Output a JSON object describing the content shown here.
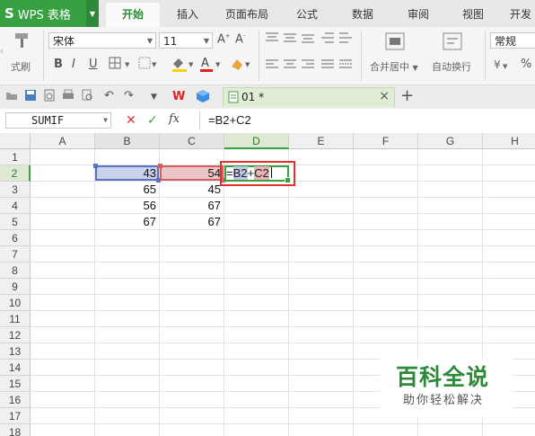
{
  "app": {
    "logo_mark": "S",
    "title": "WPS 表格"
  },
  "menu_tabs": [
    "开始",
    "插入",
    "页面布局",
    "公式",
    "数据",
    "审阅",
    "视图",
    "开发"
  ],
  "ribbon": {
    "paste_label": "式刷",
    "font_name": "宋体",
    "font_size": "11",
    "merge_label": "合并居中",
    "wrap_label": "自动换行",
    "number_format": "常规",
    "percent": "%"
  },
  "quickbar": {
    "file_tab": "01 *",
    "new_tab": "+",
    "close": "×"
  },
  "formula_bar": {
    "name_box": "SUMIF",
    "cancel": "✕",
    "confirm": "✓",
    "fx": "fx",
    "formula": "=B2+C2"
  },
  "columns": [
    "A",
    "B",
    "C",
    "D",
    "E",
    "F",
    "G",
    "H"
  ],
  "rows": [
    "1",
    "2",
    "3",
    "4",
    "5",
    "6",
    "7",
    "8",
    "9",
    "10",
    "11",
    "12",
    "13",
    "14",
    "15",
    "16",
    "17",
    "18"
  ],
  "cells": {
    "B2": "43",
    "C2": "54",
    "B3": "65",
    "C3": "45",
    "B4": "56",
    "C4": "67",
    "B5": "67",
    "C5": "67"
  },
  "edit_cell": {
    "eq": "=",
    "ref1": "B2",
    "op": "+",
    "ref2": "C2"
  },
  "watermark": {
    "title": "百科全说",
    "subtitle": "助你轻松解决"
  },
  "colors": {
    "brand": "#37a142",
    "ref_blue": "#bcc8e6",
    "ref_red": "#e8b4b4",
    "highlight_box": "#e03030"
  }
}
